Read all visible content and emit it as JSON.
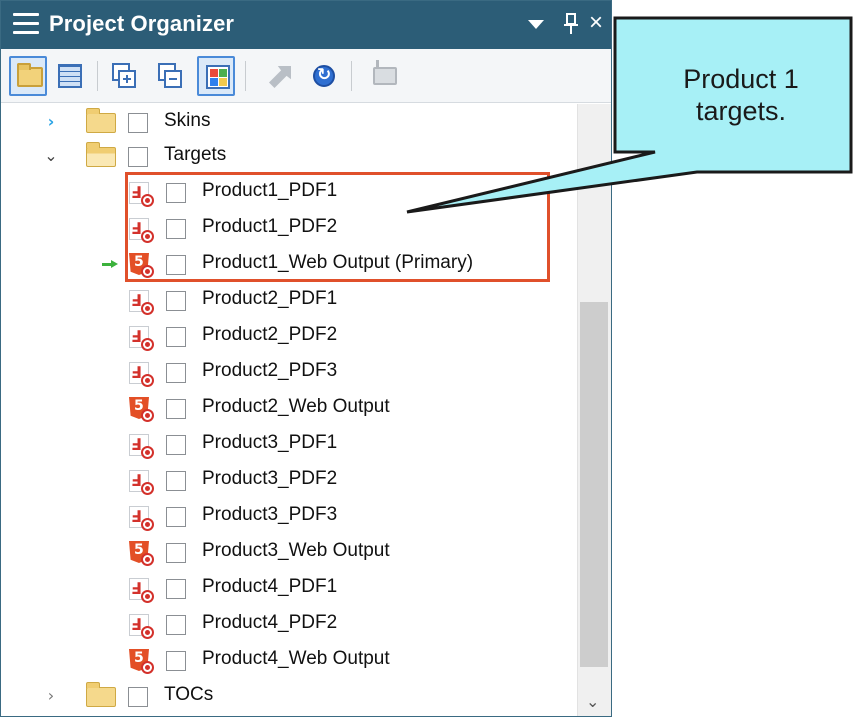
{
  "panel": {
    "title": "Project Organizer",
    "dropdown_glyph": "",
    "pin_glyph": "p",
    "close_glyph": "×"
  },
  "toolbar": {
    "buttons": [
      {
        "icon": "folder-view-icon",
        "active": true
      },
      {
        "icon": "grid-view-icon",
        "active": false
      },
      {
        "icon": "expand-all-icon",
        "active": false
      },
      {
        "icon": "collapse-all-icon",
        "active": false
      },
      {
        "icon": "tile-view-icon",
        "active": true
      },
      {
        "icon": "move-icon",
        "active": false
      },
      {
        "icon": "refresh-icon",
        "active": false
      },
      {
        "icon": "new-folder-icon",
        "active": false
      }
    ]
  },
  "tree": {
    "folders": [
      {
        "label": "Skins",
        "expanded": false
      },
      {
        "label": "Targets",
        "expanded": true
      },
      {
        "label": "TOCs",
        "expanded": false
      }
    ],
    "targets": [
      {
        "label": "Product1_PDF1",
        "type": "pdf"
      },
      {
        "label": "Product1_PDF2",
        "type": "pdf"
      },
      {
        "label": "Product1_Web Output (Primary)",
        "type": "html5",
        "primary": true
      },
      {
        "label": "Product2_PDF1",
        "type": "pdf"
      },
      {
        "label": "Product2_PDF2",
        "type": "pdf"
      },
      {
        "label": "Product2_PDF3",
        "type": "pdf"
      },
      {
        "label": "Product2_Web Output",
        "type": "html5"
      },
      {
        "label": "Product3_PDF1",
        "type": "pdf"
      },
      {
        "label": "Product3_PDF2",
        "type": "pdf"
      },
      {
        "label": "Product3_PDF3",
        "type": "pdf"
      },
      {
        "label": "Product3_Web Output",
        "type": "html5"
      },
      {
        "label": "Product4_PDF1",
        "type": "pdf"
      },
      {
        "label": "Product4_PDF2",
        "type": "pdf"
      },
      {
        "label": "Product4_Web Output",
        "type": "html5"
      }
    ]
  },
  "callout": {
    "line1": "Product 1",
    "line2": "targets."
  },
  "colors": {
    "titlebar": "#2c5d77",
    "highlight": "#e0502b",
    "callout_fill": "#a7f0f6",
    "pdf_red": "#d3312b",
    "html5_orange": "#e34f26"
  }
}
